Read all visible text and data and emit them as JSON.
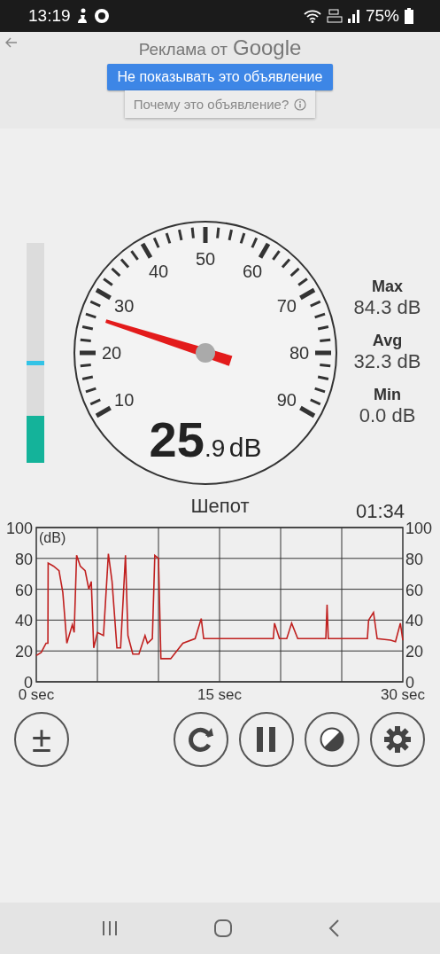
{
  "status_bar": {
    "time": "13:19",
    "battery": "75%"
  },
  "ad": {
    "title": "Реклама от",
    "brand": "Google",
    "hide_button": "Не показывать это объявление",
    "why_button": "Почему это объявление?"
  },
  "meter": {
    "level": 0.21,
    "peak": {
      "level": 0.44
    }
  },
  "gauge": {
    "labels": [
      "10",
      "20",
      "30",
      "40",
      "50",
      "60",
      "70",
      "80",
      "90"
    ],
    "reading": "25",
    "decimal": ".9",
    "unit": "dB"
  },
  "stats": [
    {
      "label": "Max",
      "value": "84.3",
      "unit": "dB"
    },
    {
      "label": "Avg",
      "value": "32.3",
      "unit": "dB"
    },
    {
      "label": "Min",
      "value": "0.0",
      "unit": "dB"
    }
  ],
  "sound_label": "Шепот",
  "elapsed": "01:34",
  "chart_data": {
    "type": "line",
    "ylabel": "(dB)",
    "xlim": [
      0,
      30
    ],
    "ylim": [
      0,
      100
    ],
    "xticks": [
      {
        "value": 0,
        "label": "0 sec"
      },
      {
        "value": 15,
        "label": "15 sec"
      },
      {
        "value": 30,
        "label": "30 sec"
      }
    ],
    "yticks": [
      0,
      20,
      40,
      60,
      80,
      100
    ],
    "y2ticks": [
      0,
      20,
      40,
      60,
      80,
      100
    ],
    "y2lim": [
      0,
      100
    ],
    "grid": true,
    "x": [
      0,
      0.4,
      0.8,
      0.95,
      0.97,
      1.4,
      1.86,
      2.17,
      2.5,
      2.95,
      3.1,
      3.3,
      3.6,
      4.0,
      4.3,
      4.5,
      4.7,
      5.0,
      5.5,
      5.9,
      6.2,
      6.6,
      6.9,
      7.3,
      7.5,
      7.9,
      8.4,
      8.9,
      9.1,
      9.5,
      9.7,
      10.0,
      10.2,
      11.0,
      12.0,
      13.0,
      13.5,
      13.7,
      15.0,
      17.0,
      19.4,
      19.5,
      19.9,
      20.5,
      20.9,
      21.4,
      22.5,
      23.7,
      23.8,
      23.9,
      25.0,
      27.1,
      27.2,
      27.6,
      27.9,
      29.0,
      29.4,
      29.8,
      30
    ],
    "series": [
      {
        "color": "#c0201f",
        "values": [
          17,
          19,
          25,
          25,
          77,
          75,
          72,
          58,
          25,
          37,
          32,
          82,
          75,
          72,
          60,
          65,
          22,
          32,
          30,
          83,
          65,
          22,
          22,
          82,
          30,
          18,
          18,
          30,
          25,
          28,
          82,
          80,
          15,
          15,
          25,
          28,
          41,
          28,
          28,
          28,
          28,
          38,
          28,
          28,
          38,
          28,
          28,
          28,
          50,
          28,
          28,
          28,
          40,
          45,
          28,
          27,
          26,
          38,
          27
        ]
      }
    ]
  },
  "buttons": [
    {
      "kind": "calibrate",
      "text": "±"
    },
    {
      "kind": "reset"
    },
    {
      "kind": "pause"
    },
    {
      "kind": "contrast"
    },
    {
      "kind": "settings"
    }
  ]
}
